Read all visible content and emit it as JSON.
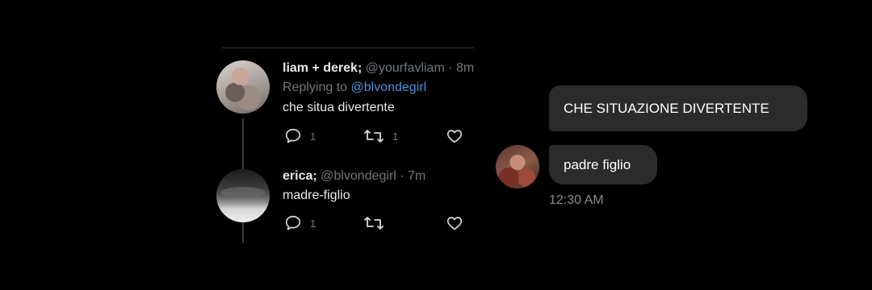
{
  "thread": {
    "tweets": [
      {
        "display_name": "liam + derek;",
        "handle": "@yourfavliam",
        "separator": "·",
        "time": "8m",
        "replying_prefix": "Replying to",
        "replying_handle": "@blvondegirl",
        "text": "che situa divertente",
        "reply_count": "1",
        "retweet_count": "1",
        "like_count": ""
      },
      {
        "display_name": "erica;",
        "handle": "@blvondegirl",
        "separator": "·",
        "time": "7m",
        "text": "madre-figlio",
        "reply_count": "1",
        "retweet_count": "",
        "like_count": ""
      }
    ]
  },
  "chat": {
    "messages": [
      {
        "text": "CHE SITUAZIONE DIVERTENTE"
      },
      {
        "text": "padre figlio"
      }
    ],
    "timestamp": "12:30 AM"
  },
  "colors": {
    "background": "#000000",
    "muted": "#71767b",
    "link": "#4f8fd6",
    "bubble": "#2b2b2b"
  },
  "icons": [
    "reply-icon",
    "retweet-icon",
    "like-icon"
  ]
}
